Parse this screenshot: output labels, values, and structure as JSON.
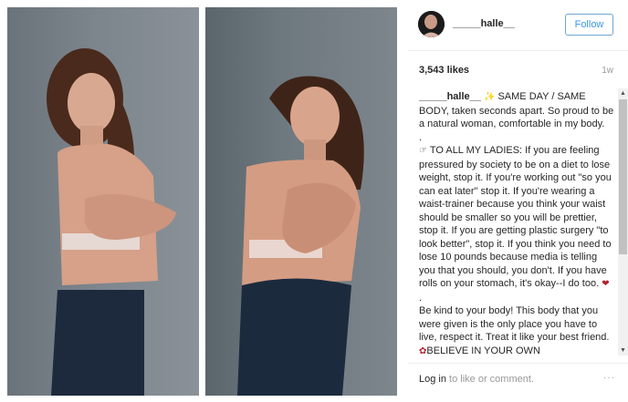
{
  "post": {
    "username": "_____halle__",
    "follow_label": "Follow",
    "likes": "3,543 likes",
    "time_ago": "1w"
  },
  "caption": {
    "author": "_____halle__",
    "line1": "SAME DAY / SAME BODY, taken seconds apart. So proud to be a natural woman, comfortable in my body.",
    "dot1": ".",
    "para2": "TO ALL MY LADIES: If you are feeling pressured by society to be on a diet to lose weight, stop it. If you're working out \"so you can eat later\" stop it. If you're wearing a waist-trainer because you think your waist should be smaller so you will be prettier, stop it. If you are getting plastic surgery \"to look better\", stop it. If you think you need to lose 10 pounds because media is telling you that you should, you don't. If you have rolls on your stomach, it's okay--I do too.",
    "dot2": ".",
    "para3": "Be kind to your body! This body that you were given is the only place you have to live, respect it. Treat it like your best friend.",
    "para3_end": "BELIEVE IN YOUR OWN"
  },
  "footer": {
    "login_link": "Log in",
    "login_text": " to like or comment.",
    "more": "···"
  },
  "icons": {
    "sparkles": "sparkles-icon",
    "pointing_hand": "pointing-hand-icon",
    "heart": "heart-icon",
    "rose": "rose-icon"
  }
}
